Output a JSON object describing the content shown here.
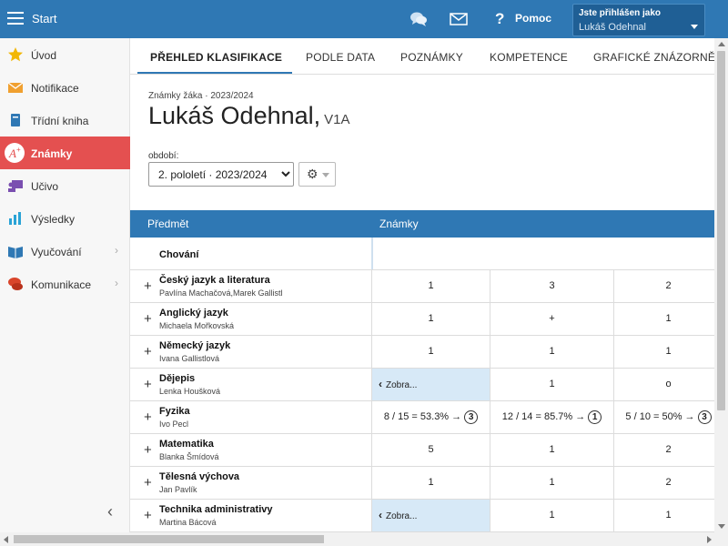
{
  "topbar": {
    "title": "Start",
    "help_label": "Pomoc",
    "user_line1": "Jste přihlášen jako",
    "user_line2": "Lukáš Odehnal",
    "color": "#2f78b4"
  },
  "sidebar": {
    "items": [
      {
        "label": "Úvod",
        "icon": "star-icon"
      },
      {
        "label": "Notifikace",
        "icon": "envelope-icon"
      },
      {
        "label": "Třídní kniha",
        "icon": "book-icon"
      },
      {
        "label": "Známky",
        "icon": "grade-icon",
        "active": true
      },
      {
        "label": "Učivo",
        "icon": "presentation-icon"
      },
      {
        "label": "Výsledky",
        "icon": "bar-chart-icon"
      },
      {
        "label": "Vyučování",
        "icon": "open-book-icon",
        "has_submenu": true
      },
      {
        "label": "Komunikace",
        "icon": "chat-icon",
        "has_submenu": true
      }
    ],
    "active_color": "#e45050"
  },
  "tabs": [
    {
      "label": "PŘEHLED KLASIFIKACE",
      "active": true
    },
    {
      "label": "PODLE DATA"
    },
    {
      "label": "POZNÁMKY"
    },
    {
      "label": "KOMPETENCE"
    },
    {
      "label": "GRAFICKÉ ZNÁZORNĚNÍ"
    }
  ],
  "header": {
    "subtitle": "Známky žáka · 2023/2024",
    "student_name": "Lukáš Odehnal,",
    "student_class": "V1A",
    "period_label": "období:",
    "period_value": "2. pololetí · 2023/2024"
  },
  "table": {
    "col_subject": "Předmět",
    "col_grades": "Známky",
    "behavior_row": "Chování",
    "collapsed_label": "Zobra...",
    "rows": [
      {
        "subject": "Český jazyk a literatura",
        "teacher": "Pavlína Machačová,Marek Gallistl",
        "cells": [
          "1",
          "3",
          "2"
        ]
      },
      {
        "subject": "Anglický jazyk",
        "teacher": "Michaela Mořkovská",
        "cells": [
          "1",
          "+",
          "1"
        ]
      },
      {
        "subject": "Německý jazyk",
        "teacher": "Ivana Gallistlová",
        "cells": [
          "1",
          "1",
          "1"
        ]
      },
      {
        "subject": "Dějepis",
        "teacher": "Lenka Houšková",
        "cells": [
          "Zobra...",
          "1",
          "o"
        ],
        "collapsed_first": true
      },
      {
        "subject": "Fyzika",
        "teacher": "Ivo Pecl",
        "cells": [
          "8 / 15 = 53.3% →",
          "12 / 14 = 85.7% →",
          "5 / 10 = 50% →"
        ],
        "badges": [
          "3",
          "1",
          "3"
        ]
      },
      {
        "subject": "Matematika",
        "teacher": "Blanka Šmídová",
        "cells": [
          "5",
          "1",
          "2"
        ]
      },
      {
        "subject": "Tělesná výchova",
        "teacher": "Jan Pavlík",
        "cells": [
          "1",
          "1",
          "2"
        ]
      },
      {
        "subject": "Technika administrativy",
        "teacher": "Martina Bácová",
        "cells": [
          "Zobra...",
          "1",
          "1"
        ],
        "collapsed_first": true
      }
    ]
  }
}
